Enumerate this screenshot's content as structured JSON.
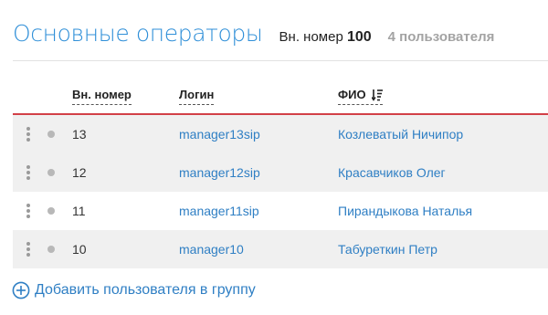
{
  "header": {
    "title": "Основные операторы",
    "ext_label": "Вн. номер",
    "ext_value": "100",
    "users_count": "4 пользователя"
  },
  "table": {
    "columns": {
      "ext": "Вн. номер",
      "login": "Логин",
      "fio": "ФИО"
    },
    "sort_icon": "sort-descending-icon",
    "rows": [
      {
        "ext": "13",
        "login": "manager13sip",
        "fio": "Козлеватый Ничипор"
      },
      {
        "ext": "12",
        "login": "manager12sip",
        "fio": "Красавчиков Олег"
      },
      {
        "ext": "11",
        "login": "manager11sip",
        "fio": "Пирандыкова Наталья"
      },
      {
        "ext": "10",
        "login": "manager10",
        "fio": "Табуреткин Петр"
      }
    ]
  },
  "add_user": {
    "label": "Добавить пользователя в группу",
    "icon": "plus-circle-icon"
  },
  "colors": {
    "accent": "#2f8fd8",
    "link": "#2f7fc4",
    "divider_red": "#d24048",
    "row_shade": "#f0f0f0"
  }
}
